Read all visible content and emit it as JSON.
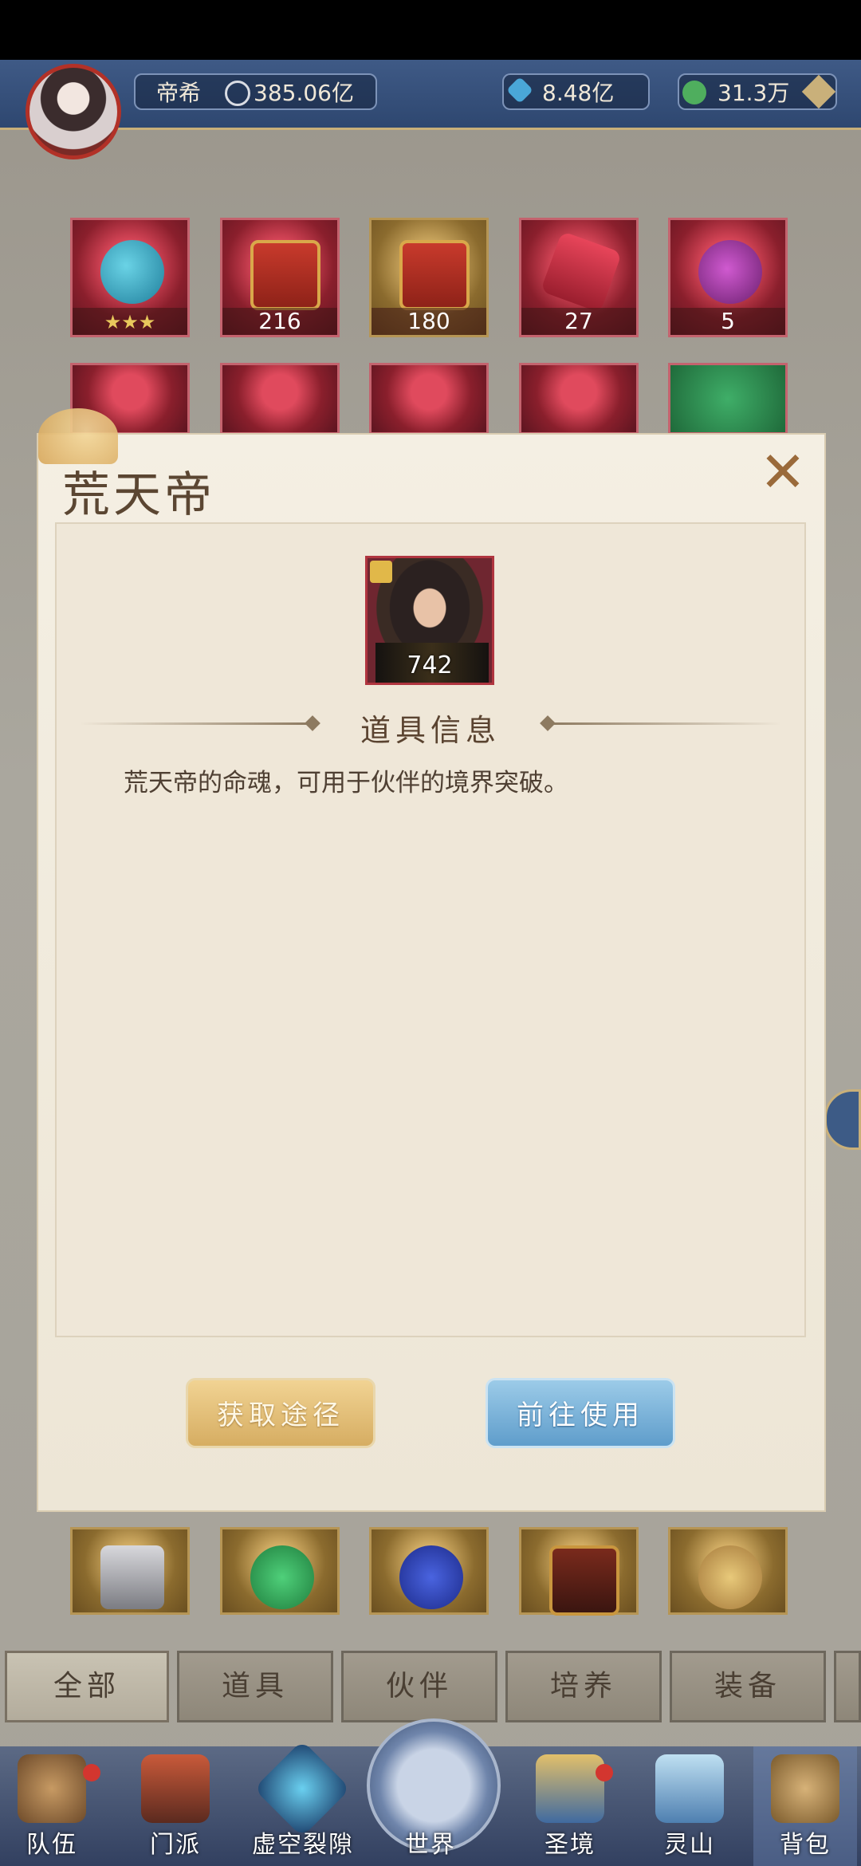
{
  "header": {
    "player_name": "帝希",
    "power_value": "385.06亿",
    "gems": "8.48亿",
    "coins": "31.3万"
  },
  "inventory": {
    "row1_counts": [
      "",
      "216",
      "180",
      "27",
      "5"
    ],
    "row1_stars": "★★★"
  },
  "modal": {
    "title": "荒天帝",
    "close_symbol": "✕",
    "item_count": "742",
    "section_title": "道具信息",
    "description": "荒天帝的命魂，可用于伙伴的境界突破。",
    "acquire_button": "获取途径",
    "use_button": "前往使用"
  },
  "tabs": [
    "全部",
    "道具",
    "伙伴",
    "培养",
    "装备"
  ],
  "nav": [
    "队伍",
    "门派",
    "虚空裂隙",
    "世界",
    "圣境",
    "灵山",
    "背包"
  ],
  "colors": {
    "modal_bg": "#f4efe3",
    "accent_gold": "#d6ad62",
    "accent_blue": "#5f9dcb",
    "navbar": "#324060"
  }
}
